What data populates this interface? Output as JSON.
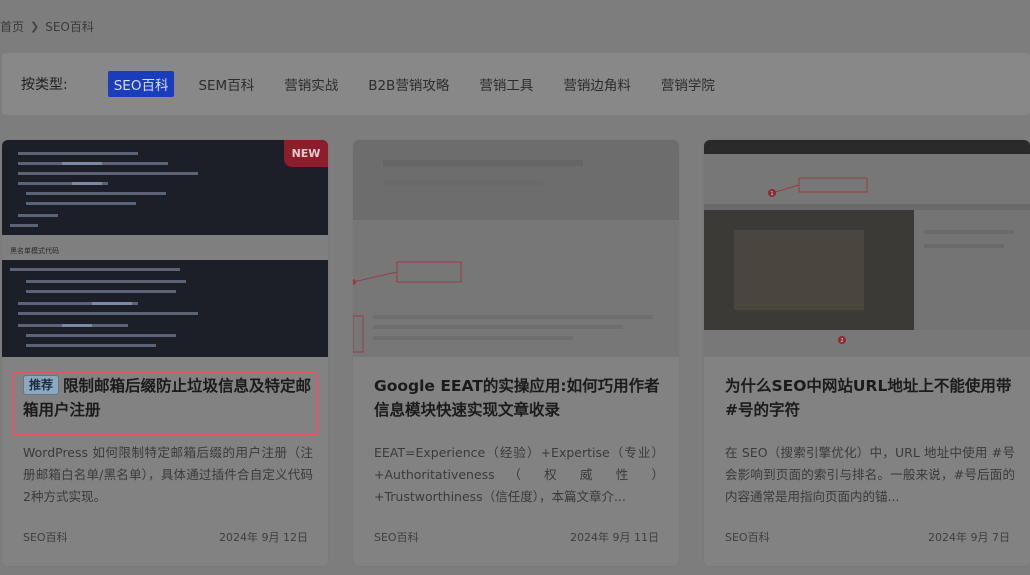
{
  "breadcrumb": {
    "home": "首页",
    "current": "SEO百科"
  },
  "filter": {
    "label": "按类型:",
    "tabs": [
      "SEO百科",
      "SEM百科",
      "营销实战",
      "B2B营销攻略",
      "营销工具",
      "营销边角料",
      "营销学院"
    ],
    "active_index": 0
  },
  "cards": [
    {
      "badge": "NEW",
      "tag": "推荐",
      "title": "限制邮箱后缀防止垃圾信息及特定邮箱用户注册",
      "desc": "WordPress 如何限制特定邮箱后缀的用户注册（注册邮箱白名单/黑名单），具体通过插件合自定义代码2种方式实现。",
      "category": "SEO百科",
      "date": "2024年 9月 12日",
      "thumb_heading": "黑名单模式代码"
    },
    {
      "title": "Google EEAT的实操应用:如何巧用作者信息模块快速实现文章收录",
      "desc": "EEAT=Experience（经验）+Expertise（专业）+Authoritativeness （ 权 威 性 ）+Trustworthiness（信任度），本篇文章介...",
      "category": "SEO百科",
      "date": "2024年 9月 11日"
    },
    {
      "title": "为什么SEO中网站URL地址上不能使用带#号的字符",
      "desc": "在 SEO（搜索引擎优化）中，URL 地址中使用 #号会影响到页面的索引与排名。一般来说，#号后面的内容通常是用指向页面内的锚...",
      "category": "SEO百科",
      "date": "2024年 9月 7日",
      "thumb_markers": [
        "1",
        "2"
      ]
    }
  ],
  "colors": {
    "accent": "#1a3dbd",
    "highlight": "#e25563",
    "new_badge": "#8c1d2a"
  }
}
